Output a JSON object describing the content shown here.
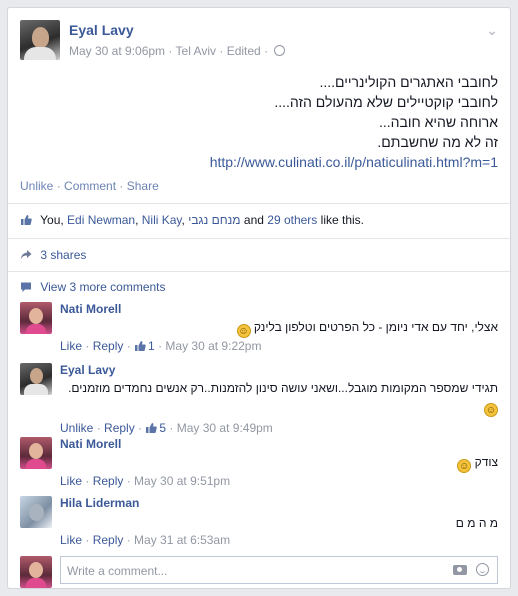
{
  "post": {
    "author": "Eyal Lavy",
    "date": "May 30 at 9:06pm",
    "location": "Tel Aviv",
    "edited": "Edited",
    "lines": [
      "לחובבי האתגרים הקולינריים....",
      "לחובבי קוקטיילים שלא מהעולם הזה....",
      "ארוחה שהיא חובה...",
      "זה לא מה שחשבתם."
    ],
    "link": "http://www.culinati.co.il/p/naticulinati.html?m=1",
    "actions": [
      "Unlike",
      "Comment",
      "Share"
    ]
  },
  "likes": {
    "you": "You",
    "names": [
      "Edi Newman",
      "Nili Kay",
      "מנחם נגבי"
    ],
    "and": "and",
    "others": "29 others",
    "suffix": "like this."
  },
  "shares": "3 shares",
  "view_more": "View 3 more comments",
  "comments": [
    {
      "name": "Nati Morell",
      "text": "אצלי, יחד עם אדי ניומן - כל הפרטים וטלפון בלינק",
      "emoji": "smile",
      "action": "Like",
      "reply": "Reply",
      "likes": "1",
      "time": "May 30 at 9:22pm"
    },
    {
      "name": "Eyal Lavy",
      "text": "תגידי שמספר המקומות מוגבל...ושאני עושה סינון להזמנות..רק אנשים נחמדים מוזמנים.",
      "emoji": "smile",
      "action": "Unlike",
      "reply": "Reply",
      "likes": "5",
      "time": "May 30 at 9:49pm"
    },
    {
      "name": "Nati Morell",
      "text": "צודק",
      "emoji": "smile",
      "action": "Like",
      "reply": "Reply",
      "time": "May 30 at 9:51pm"
    },
    {
      "name": "Hila Liderman",
      "text": "מ ה מ ם",
      "action": "Like",
      "reply": "Reply",
      "time": "May 31 at 6:53am"
    }
  ],
  "composer": {
    "placeholder": "Write a comment..."
  },
  "colors": {
    "link": "#3b5998",
    "meta": "#9197a3",
    "border": "#d3d6db"
  }
}
